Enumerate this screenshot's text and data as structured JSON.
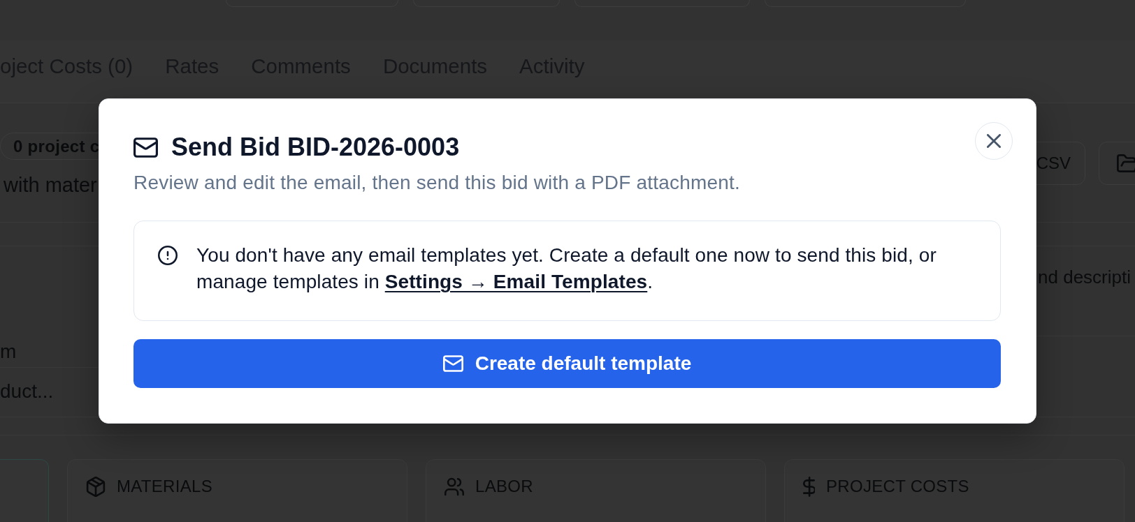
{
  "tabs": [
    {
      "label": "oject Costs (0)",
      "selected": false
    },
    {
      "label": "Rates",
      "selected": false
    },
    {
      "label": "Comments",
      "selected": false
    },
    {
      "label": "Documents",
      "selected": false
    },
    {
      "label": "Activity",
      "selected": false
    }
  ],
  "toolbar": {
    "badge": "0 project c",
    "note": "with mater",
    "buttons": [
      {
        "kind": "text",
        "label": "CSV"
      },
      {
        "kind": "folder"
      }
    ]
  },
  "items": {
    "hint": "nd descripti",
    "column_1": "m",
    "search": {
      "placeholder": "duct..."
    }
  },
  "summary_cards": [
    {
      "kind": "materials",
      "label": "MATERIALS"
    },
    {
      "kind": "labor",
      "label": "LABOR"
    },
    {
      "kind": "project_costs",
      "label": "PROJECT COSTS"
    }
  ],
  "dialog": {
    "title": "Send Bid BID-2026-0003",
    "description": "Review and edit the email, then send this bid with a PDF attachment.",
    "notice": {
      "before": "You don't have any email templates yet. Create a default one now to send this bid, or manage templates in ",
      "link": "Settings → Email Templates",
      "after": "."
    },
    "primary_button": {
      "label": "Create default template"
    }
  }
}
